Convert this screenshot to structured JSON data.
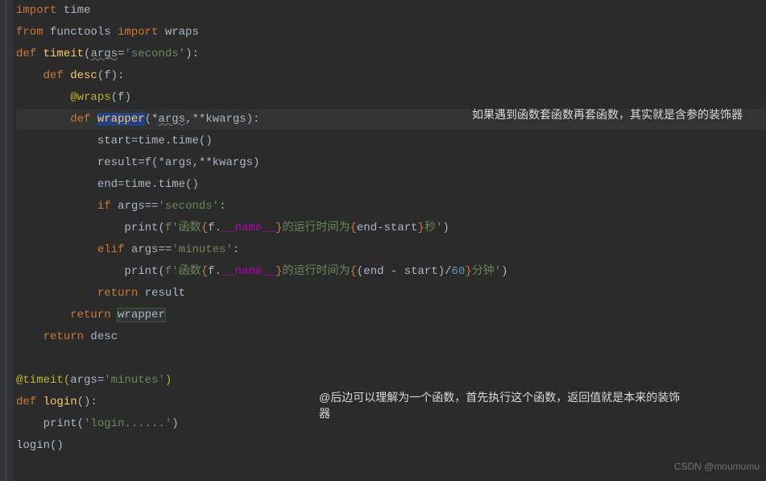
{
  "code": {
    "l1_import": "import",
    "l1_mod": " time",
    "l2_from": "from",
    "l2_mod": " functools ",
    "l2_import": "import",
    "l2_names": " wraps",
    "l3_def": "def ",
    "l3_name": "timeit",
    "l3_open": "(",
    "l3_param": "args",
    "l3_eq": "=",
    "l3_val": "'seconds'",
    "l3_close": "):",
    "l4_indent": "    ",
    "l4_def": "def ",
    "l4_name": "desc",
    "l4_sig": "(f):",
    "l5_indent": "        ",
    "l5_at": "@wraps",
    "l5_arg": "(f)",
    "l6_indent": "        ",
    "l6_def": "def ",
    "l6_name": "wrapper",
    "l6_open": "(*",
    "l6_args": "args",
    "l6_mid": ",**",
    "l6_kwargs": "kwargs",
    "l6_close": "):",
    "l7_indent": "            ",
    "l7_code": "start=time.time()",
    "l8_indent": "            ",
    "l8_code": "result=f(*args,**kwargs)",
    "l9_indent": "            ",
    "l9_code": "end=time.time()",
    "l10_indent": "            ",
    "l10_if": "if ",
    "l10_cond": "args==",
    "l10_str": "'seconds'",
    "l10_colon": ":",
    "l11_indent": "                ",
    "l11_print": "print(",
    "l11_fopen": "f'",
    "l11_s1": "函数",
    "l11_b1": "{",
    "l11_fexpr": "f.",
    "l11_name": "__name__",
    "l11_b2": "}",
    "l11_s2": "的运行时间为",
    "l11_b3": "{",
    "l11_expr2": "end-start",
    "l11_b4": "}",
    "l11_s3": "秒",
    "l11_fclose": "'",
    "l11_close": ")",
    "l12_indent": "            ",
    "l12_elif": "elif ",
    "l12_cond": "args==",
    "l12_str": "'minutes'",
    "l12_colon": ":",
    "l13_indent": "                ",
    "l13_print": "print(",
    "l13_fopen": "f'",
    "l13_s1": "函数",
    "l13_b1": "{",
    "l13_fexpr": "f.",
    "l13_name": "__name__",
    "l13_b2": "}",
    "l13_s2": "的运行时间为",
    "l13_b3": "{",
    "l13_expr2": "(end - start)/",
    "l13_num": "60",
    "l13_b4": "}",
    "l13_s3": "分钟",
    "l13_fclose": "'",
    "l13_close": ")",
    "l14_indent": "            ",
    "l14_return": "return ",
    "l14_val": "result",
    "l15_indent": "        ",
    "l15_return": "return ",
    "l15_val": "wrapper",
    "l16_indent": "    ",
    "l16_return": "return ",
    "l16_val": "desc",
    "l17": "",
    "l18_at": "@timeit",
    "l18_open": "(",
    "l18_param": "args",
    "l18_eq": "=",
    "l18_val": "'minutes'",
    "l18_close": ")",
    "l19_def": "def ",
    "l19_name": "login",
    "l19_sig": "():",
    "l20_indent": "    ",
    "l20_print": "print(",
    "l20_str": "'login......'",
    "l20_close": ")",
    "l21": "login()"
  },
  "annotations": {
    "a1": "如果遇到函数套函数再套函数，其实就是含参的装饰器",
    "a2": "@后边可以理解为一个函数，首先执行这个函数，返回值就是本来的装饰器"
  },
  "watermark": "CSDN @moumumu"
}
